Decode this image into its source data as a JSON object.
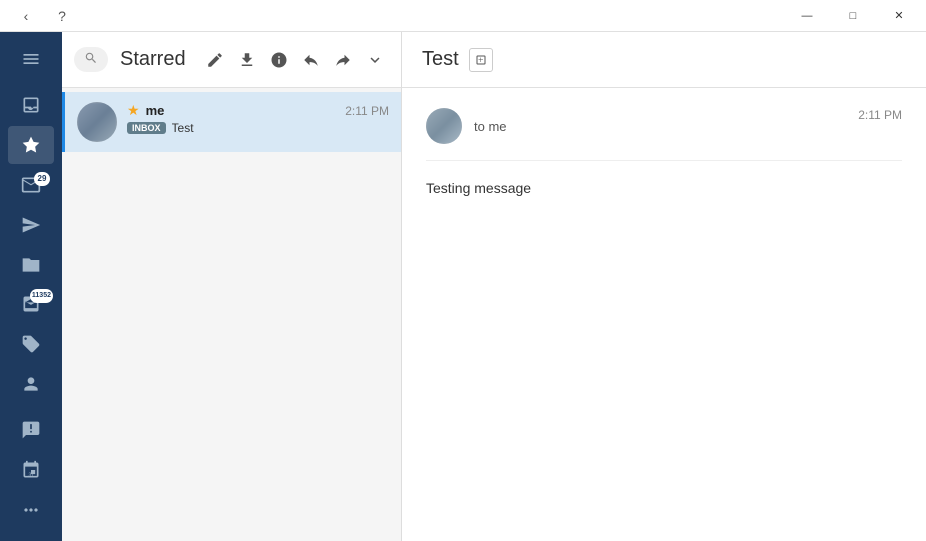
{
  "titlebar": {
    "back_label": "‹",
    "help_label": "?",
    "minimize_label": "—",
    "maximize_label": "□",
    "close_label": "✕"
  },
  "sidebar": {
    "menu_icon": "≡",
    "items": [
      {
        "name": "inbox-icon",
        "icon": "inbox",
        "badge": null,
        "active": false
      },
      {
        "name": "starred-icon",
        "icon": "star",
        "badge": null,
        "active": true
      },
      {
        "name": "drafts-icon",
        "icon": "draft",
        "badge": "29",
        "active": false
      },
      {
        "name": "sent-icon",
        "icon": "sent",
        "badge": null,
        "active": false
      },
      {
        "name": "spam-icon",
        "icon": "spam",
        "badge": null,
        "active": false
      },
      {
        "name": "all-mail-icon",
        "icon": "all",
        "badge": "11352",
        "active": false
      },
      {
        "name": "tags-icon",
        "icon": "tag",
        "badge": null,
        "active": false
      }
    ],
    "bottom_items": [
      {
        "name": "contacts-icon",
        "icon": "contacts"
      },
      {
        "name": "contact-detail-icon",
        "icon": "contact-detail"
      },
      {
        "name": "calendar-icon",
        "icon": "calendar"
      },
      {
        "name": "more-icon",
        "icon": "more"
      }
    ]
  },
  "email_list": {
    "search_placeholder": "Search",
    "folder_title": "Starred",
    "toolbar_actions": [
      "compose",
      "download",
      "info",
      "reply",
      "forward",
      "dropdown"
    ],
    "emails": [
      {
        "sender": "me",
        "time": "2:11 PM",
        "tag": "Inbox",
        "subject": "Test",
        "starred": true
      }
    ]
  },
  "email_detail": {
    "title": "Test",
    "from_label": "to me",
    "time": "2:11 PM",
    "body": "Testing message"
  }
}
